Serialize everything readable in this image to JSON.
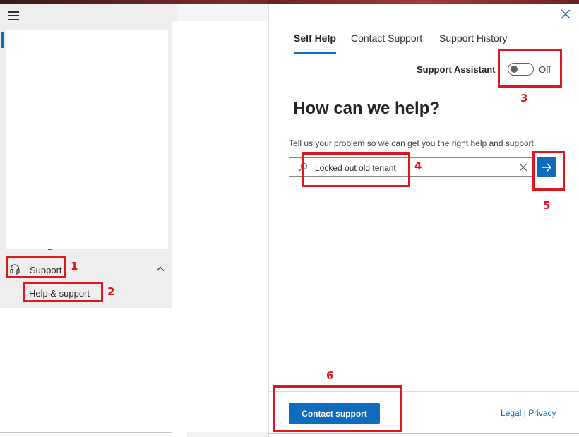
{
  "nav": {
    "menu_icon": "hamburger-menu-icon",
    "support_icon": "headset-icon",
    "support_label": "Support",
    "help_label": "Help & support"
  },
  "panel": {
    "tabs": [
      {
        "label": "Self Help",
        "active": true
      },
      {
        "label": "Contact Support",
        "active": false
      },
      {
        "label": "Support History",
        "active": false
      }
    ],
    "assistant": {
      "label": "Support Assistant",
      "state": "Off"
    },
    "title": "How can we help?",
    "description": "Tell us your problem so we can get you the right help and support.",
    "search": {
      "value": "Locked out old tenant"
    },
    "contact_button": "Contact support",
    "legal": {
      "legal_label": "Legal",
      "separator": "|",
      "privacy_label": "Privacy"
    }
  },
  "annotations": [
    "1",
    "2",
    "3",
    "4",
    "5",
    "6"
  ],
  "colors": {
    "accent": "#0f6cbd",
    "annotation": "#e0161e"
  }
}
